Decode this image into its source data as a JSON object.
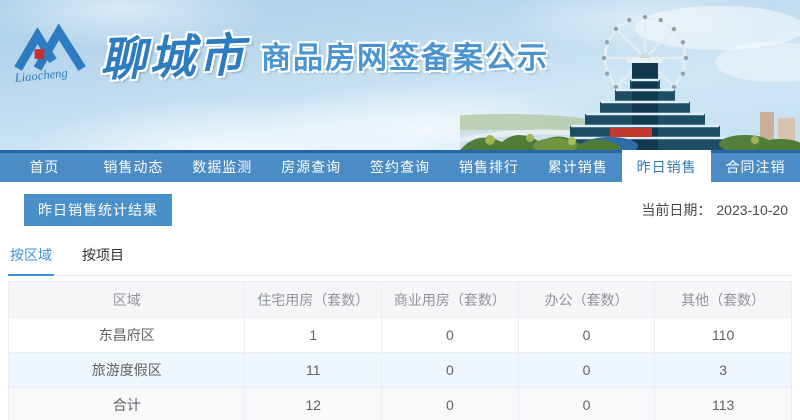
{
  "header": {
    "logo_text_en": "Liaocheng",
    "logo_city": "聊城市",
    "site_title": "商品房网签备案公示"
  },
  "nav": {
    "items": [
      {
        "label": "首页",
        "active": false
      },
      {
        "label": "销售动态",
        "active": false
      },
      {
        "label": "数据监测",
        "active": false
      },
      {
        "label": "房源查询",
        "active": false
      },
      {
        "label": "签约查询",
        "active": false
      },
      {
        "label": "销售排行",
        "active": false
      },
      {
        "label": "累计销售",
        "active": false
      },
      {
        "label": "昨日销售",
        "active": true
      },
      {
        "label": "合同注销",
        "active": false
      }
    ]
  },
  "content": {
    "section_title": "昨日销售统计结果",
    "date_label": "当前日期：",
    "date_value": "2023-10-20",
    "tabs": [
      {
        "label": "按区域",
        "active": true
      },
      {
        "label": "按项目",
        "active": false
      }
    ]
  },
  "table": {
    "columns": [
      "区域",
      "住宅用房（套数）",
      "商业用房（套数）",
      "办公（套数）",
      "其他（套数）"
    ],
    "rows": [
      {
        "region": "东昌府区",
        "values": [
          "1",
          "0",
          "0",
          "110"
        ]
      },
      {
        "region": "旅游度假区",
        "values": [
          "11",
          "0",
          "0",
          "3"
        ]
      },
      {
        "region": "合计",
        "values": [
          "12",
          "0",
          "0",
          "113"
        ]
      }
    ]
  },
  "colors": {
    "nav_bg": "#4a8cc3",
    "nav_top_border": "#2767a7",
    "nav_active_text": "#3579b5",
    "badge_bg": "#4a90c8",
    "tab_active_blue": "#3f8fd9",
    "title_blue": "#4a94cf",
    "logo_blue": "#2e7cc0",
    "logo_red": "#c62f2f",
    "table_border": "#ebeef5",
    "table_header_bg": "#f5f6f8",
    "table_header_text": "#909399",
    "cell_text": "#606266",
    "stripe_row_bg": "#eff7fd",
    "total_row_bg": "#f8f9fa"
  }
}
